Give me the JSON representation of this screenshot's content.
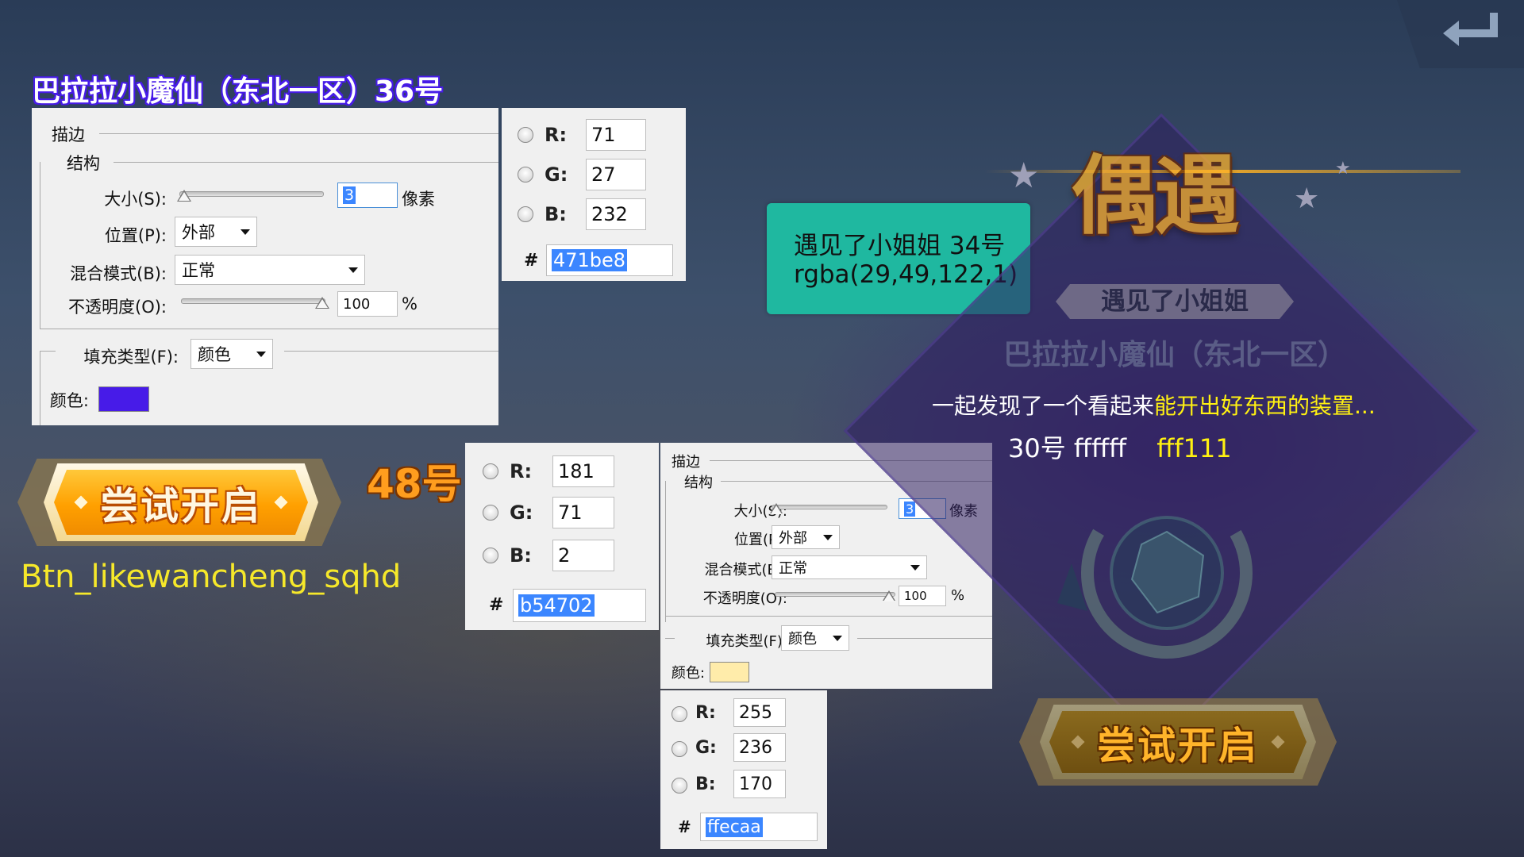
{
  "title_36": "巴拉拉小魔仙（东北一区）36号",
  "panel1": {
    "section_stroke": "描边",
    "section_structure": "结构",
    "size_label": "大小(S):",
    "size_value": "3",
    "size_unit": "像素",
    "position_label": "位置(P):",
    "position_value": "外部",
    "blend_label": "混合模式(B):",
    "blend_value": "正常",
    "opacity_label": "不透明度(O):",
    "opacity_value": "100",
    "opacity_unit": "%",
    "fill_label": "填充类型(F):",
    "fill_value": "颜色",
    "color_label": "颜色:",
    "color_swatch": "#471be8"
  },
  "rgb1": {
    "r_label": "R:",
    "r": "71",
    "g_label": "G:",
    "g": "27",
    "b_label": "B:",
    "b": "232",
    "hash": "#",
    "hex": "471be8"
  },
  "teal_box": {
    "line1": "遇见了小姐姐 34号",
    "line2": "rgba(29,49,122,1)",
    "bg": "#1fb8a0"
  },
  "label_48": "48号",
  "button_left": {
    "label": "尝试开启"
  },
  "btn_name": "Btn_likewancheng_sqhd",
  "rgb2": {
    "r_label": "R:",
    "r": "181",
    "g_label": "G:",
    "g": "71",
    "b_label": "B:",
    "b": "2",
    "hash": "#",
    "hex": "b54702"
  },
  "panel2": {
    "section_stroke": "描边",
    "section_structure": "结构",
    "size_label": "大小(S):",
    "size_value": "3",
    "size_unit": "像素",
    "position_label": "位置(P):",
    "position_value": "外部",
    "blend_label": "混合模式(B):",
    "blend_value": "正常",
    "opacity_label": "不透明度(O):",
    "opacity_value": "100",
    "opacity_unit": "%",
    "fill_label": "填充类型(F):",
    "fill_value": "颜色",
    "color_label": "颜色:",
    "color_swatch": "#ffecaa"
  },
  "rgb3": {
    "r_label": "R:",
    "r": "255",
    "g_label": "G:",
    "g": "236",
    "b_label": "B:",
    "b": "170",
    "hash": "#",
    "hex": "ffecaa"
  },
  "game": {
    "banner_title": "偶遇",
    "subtitle": "遇见了小姐姐",
    "server": "巴拉拉小魔仙（东北一区）",
    "desc_white": "一起发现了一个看起来",
    "desc_yellow": "能开出好东西的装置...",
    "note_white": "30号 ffffff",
    "note_yellow": "fff111",
    "button_label": "尝试开启",
    "back_icon": "return-arrow-icon"
  }
}
